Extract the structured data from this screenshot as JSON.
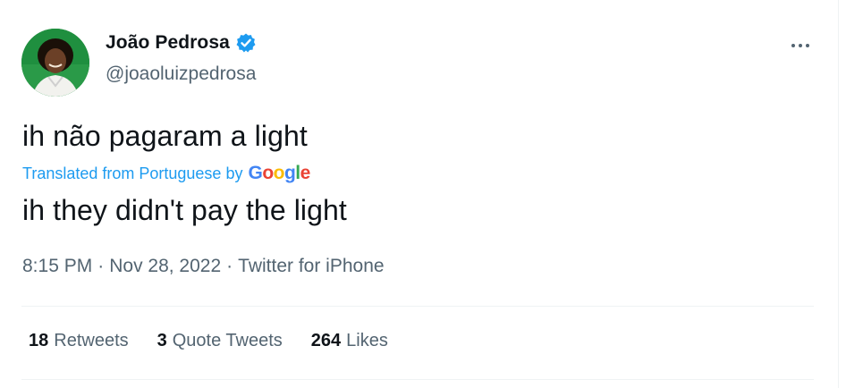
{
  "user": {
    "display_name": "João Pedrosa",
    "handle": "@joaoluizpedrosa",
    "verified": true
  },
  "tweet": {
    "text": "ih não pagaram a light",
    "translated_label": "Translated from Portuguese by",
    "translator_logo": [
      "G",
      "o",
      "o",
      "g",
      "l",
      "e"
    ],
    "translated_text": "ih they didn't pay the light"
  },
  "meta": {
    "time": "8:15 PM",
    "separator": "·",
    "date": "Nov 28, 2022",
    "source": "Twitter for iPhone"
  },
  "stats": [
    {
      "count": "18",
      "label": "Retweets"
    },
    {
      "count": "3",
      "label": "Quote Tweets"
    },
    {
      "count": "264",
      "label": "Likes"
    }
  ],
  "colors": {
    "accent": "#1d9bf0",
    "text": "#0f1419",
    "secondary": "#536471",
    "google": [
      "#4285F4",
      "#EA4335",
      "#FBBC05",
      "#4285F4",
      "#34A853",
      "#EA4335"
    ]
  },
  "icons": {
    "verified": "verified-badge-icon",
    "more": "more-options-icon"
  }
}
